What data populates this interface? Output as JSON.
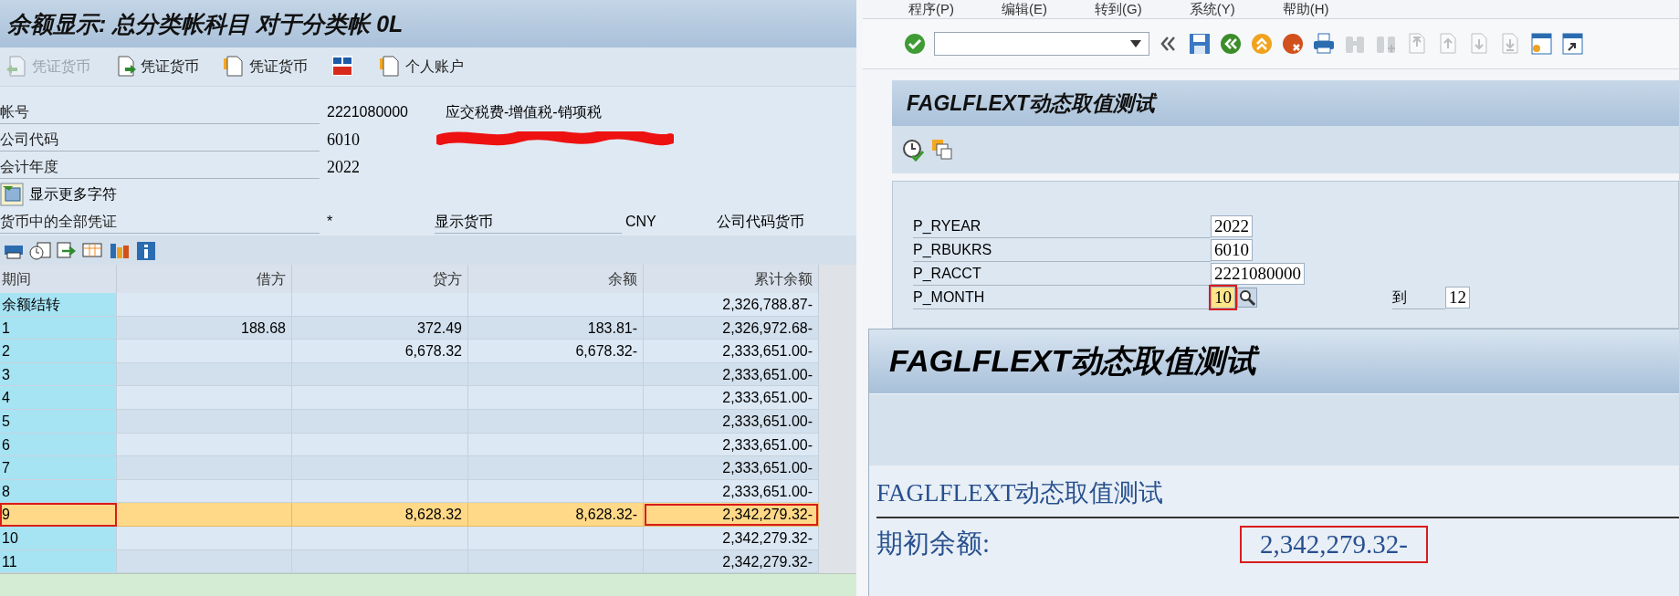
{
  "balance_window": {
    "title": "余额显示: 总分类帐科目 对于分类帐 0L",
    "toolbar": [
      {
        "kind": "doc-back",
        "label": "凭证货币",
        "disabled": true
      },
      {
        "kind": "doc-forward",
        "label": "凭证货币",
        "disabled": false
      },
      {
        "kind": "doc-copy",
        "label": "凭证货币",
        "disabled": false
      },
      {
        "kind": "currency",
        "disabled": false
      },
      {
        "kind": "doc-copy",
        "label": "个人账户",
        "disabled": false
      }
    ],
    "header_fields": [
      {
        "label": "帐号",
        "value": "2221080000",
        "description": "应交税费-增值税-销项税",
        "redacted": false
      },
      {
        "label": "公司代码",
        "value": "6010",
        "redacted": true
      },
      {
        "label": "会计年度",
        "value": "2022",
        "redacted": false
      }
    ],
    "more_button": "显示更多字符",
    "currency_row": {
      "label": "货币中的全部凭证",
      "value": "*",
      "display_label": "显示货币",
      "display_value": "CNY",
      "note": "公司代码货币"
    },
    "table": {
      "columns": [
        "期间",
        "借方",
        "贷方",
        "余额",
        "累计余额"
      ],
      "rows": [
        {
          "cells": [
            "余额结转",
            "",
            "",
            "",
            "2,326,788.87-"
          ],
          "selected": false,
          "marked": false
        },
        {
          "cells": [
            "1",
            "188.68",
            "372.49",
            "183.81-",
            "2,326,972.68-"
          ],
          "selected": false,
          "marked": false
        },
        {
          "cells": [
            "2",
            "",
            "6,678.32",
            "6,678.32-",
            "2,333,651.00-"
          ],
          "selected": false,
          "marked": false
        },
        {
          "cells": [
            "3",
            "",
            "",
            "",
            "2,333,651.00-"
          ],
          "selected": false,
          "marked": false
        },
        {
          "cells": [
            "4",
            "",
            "",
            "",
            "2,333,651.00-"
          ],
          "selected": false,
          "marked": false
        },
        {
          "cells": [
            "5",
            "",
            "",
            "",
            "2,333,651.00-"
          ],
          "selected": false,
          "marked": false
        },
        {
          "cells": [
            "6",
            "",
            "",
            "",
            "2,333,651.00-"
          ],
          "selected": false,
          "marked": false
        },
        {
          "cells": [
            "7",
            "",
            "",
            "",
            "2,333,651.00-"
          ],
          "selected": false,
          "marked": false
        },
        {
          "cells": [
            "8",
            "",
            "",
            "",
            "2,333,651.00-"
          ],
          "selected": false,
          "marked": false
        },
        {
          "cells": [
            "9",
            "",
            "8,628.32",
            "8,628.32-",
            "2,342,279.32-"
          ],
          "selected": true,
          "marked": true
        },
        {
          "cells": [
            "10",
            "",
            "",
            "",
            "2,342,279.32-"
          ],
          "selected": false,
          "marked": false
        },
        {
          "cells": [
            "11",
            "",
            "",
            "",
            "2,342,279.32-"
          ],
          "selected": false,
          "marked": false
        }
      ]
    }
  },
  "selection_window": {
    "menu": [
      "程序(P)",
      "编辑(E)",
      "转到(G)",
      "系统(Y)",
      "帮助(H)"
    ],
    "toolbar_icons": [
      {
        "kind": "ok",
        "disabled": false
      },
      {
        "kind": "command-field"
      },
      {
        "kind": "chevrons",
        "disabled": false
      },
      {
        "kind": "save",
        "disabled": false
      },
      {
        "kind": "back",
        "disabled": false
      },
      {
        "kind": "exit",
        "disabled": false
      },
      {
        "kind": "cancel",
        "disabled": false
      },
      {
        "kind": "print",
        "disabled": false
      },
      {
        "kind": "find",
        "disabled": true
      },
      {
        "kind": "find-next",
        "disabled": true
      },
      {
        "kind": "page-first",
        "disabled": true
      },
      {
        "kind": "page-up",
        "disabled": true
      },
      {
        "kind": "page-down",
        "disabled": true
      },
      {
        "kind": "page-last",
        "disabled": true
      },
      {
        "kind": "new-session",
        "disabled": false
      },
      {
        "kind": "shortcut",
        "disabled": false
      }
    ],
    "title": "FAGLFLEXT动态取值测试",
    "params": [
      {
        "label": "P_RYEAR",
        "value": "2022",
        "focused": false
      },
      {
        "label": "P_RBUKRS",
        "value": "6010",
        "focused": false
      },
      {
        "label": "P_RACCT",
        "value": "2221080000",
        "focused": false
      },
      {
        "label": "P_MONTH",
        "value": "10",
        "focused": true,
        "to_label": "到",
        "to_value": "12"
      }
    ]
  },
  "result_window": {
    "title": "FAGLFLEXT动态取值测试",
    "heading": "FAGLFLEXT动态取值测试",
    "label": "期初余额:",
    "value": "2,342,279.32-",
    "marked": true
  }
}
